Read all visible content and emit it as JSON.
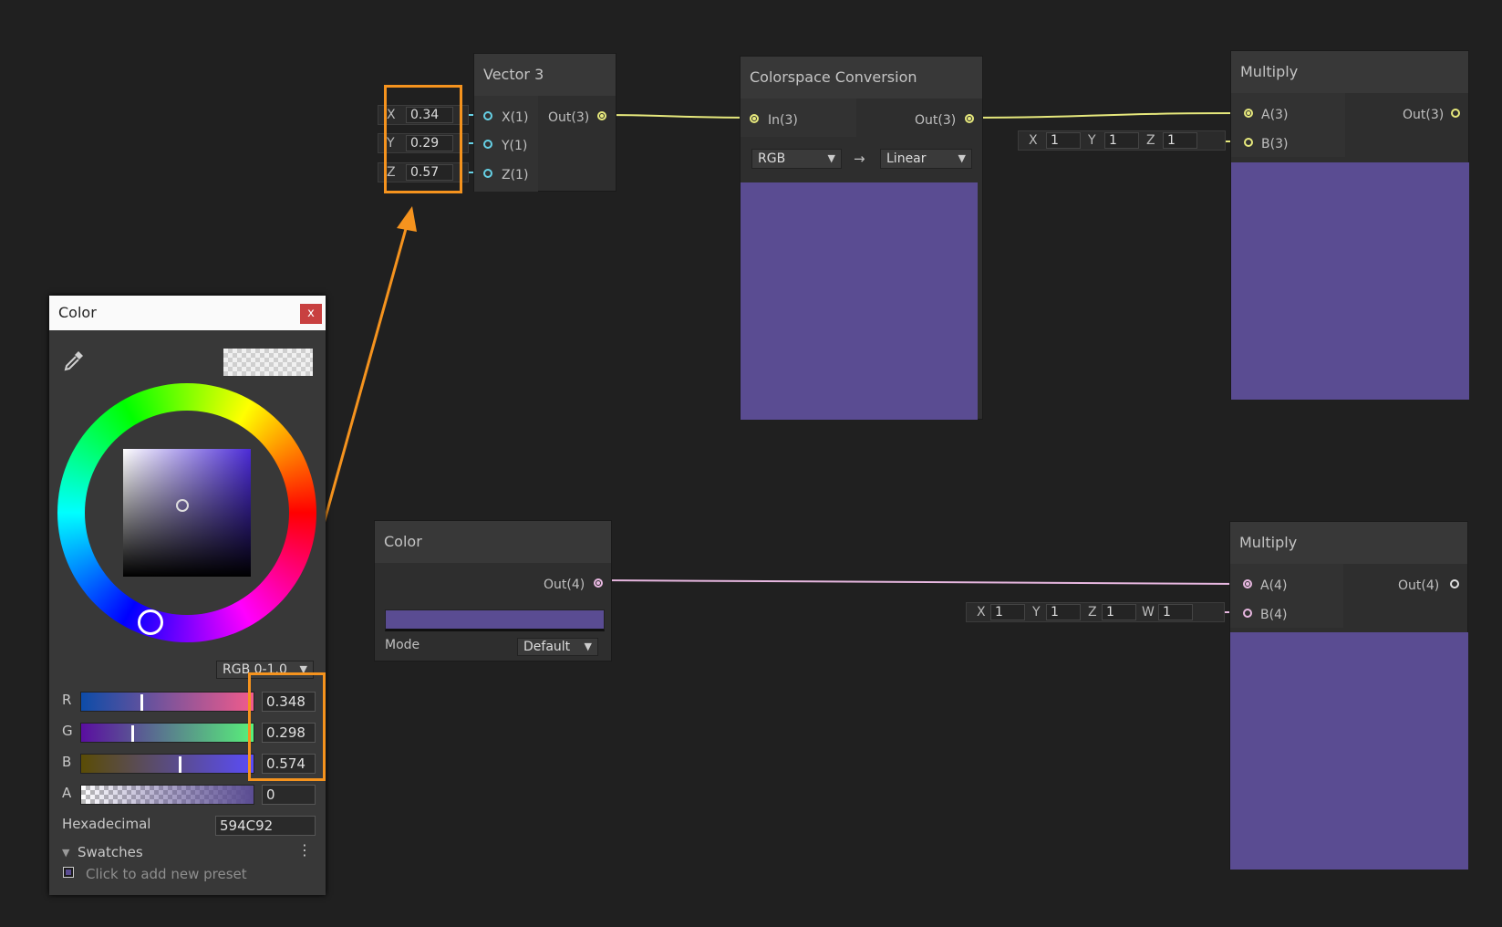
{
  "vector3_node": {
    "title": "Vector 3",
    "inputs": [
      {
        "axis": "X",
        "value": "0.34",
        "label": "X(1)"
      },
      {
        "axis": "Y",
        "value": "0.29",
        "label": "Y(1)"
      },
      {
        "axis": "Z",
        "value": "0.57",
        "label": "Z(1)"
      }
    ],
    "output_label": "Out(3)"
  },
  "colorspace_node": {
    "title": "Colorspace Conversion",
    "input_label": "In(3)",
    "output_label": "Out(3)",
    "from_option": "RGB",
    "arrow": "→",
    "to_option": "Linear",
    "preview_color": "#5a4c92"
  },
  "multiply_top": {
    "title": "Multiply",
    "input_a": "A(3)",
    "input_b": "B(3)",
    "output_label": "Out(3)",
    "b_defaults": [
      {
        "axis": "X",
        "value": "1"
      },
      {
        "axis": "Y",
        "value": "1"
      },
      {
        "axis": "Z",
        "value": "1"
      }
    ]
  },
  "color_node": {
    "title": "Color",
    "output_label": "Out(4)",
    "mode_label": "Mode",
    "mode_value": "Default",
    "swatch_color": "#5a4c92"
  },
  "multiply_bottom": {
    "title": "Multiply",
    "input_a": "A(4)",
    "input_b": "B(4)",
    "output_label": "Out(4)",
    "b_defaults": [
      {
        "axis": "X",
        "value": "1"
      },
      {
        "axis": "Y",
        "value": "1"
      },
      {
        "axis": "Z",
        "value": "1"
      },
      {
        "axis": "W",
        "value": "1"
      }
    ]
  },
  "color_picker": {
    "title": "Color",
    "close": "x",
    "mode": "RGB 0-1.0",
    "channels": [
      {
        "name": "R",
        "value": "0.348",
        "level": 0.348
      },
      {
        "name": "G",
        "value": "0.298",
        "level": 0.298
      },
      {
        "name": "B",
        "value": "0.574",
        "level": 0.574
      },
      {
        "name": "A",
        "value": "0",
        "level": 0
      }
    ],
    "hex_label": "Hexadecimal",
    "hex_value": "594C92",
    "swatches_label": "Swatches",
    "add_preset": "Click to add new preset"
  },
  "colors": {
    "accent": "#f5931e",
    "preview": "#5a4c92",
    "edge_yellow": "#e6e87c",
    "edge_pink": "#e7b7e0",
    "edge_cyan": "#66d1e6"
  }
}
